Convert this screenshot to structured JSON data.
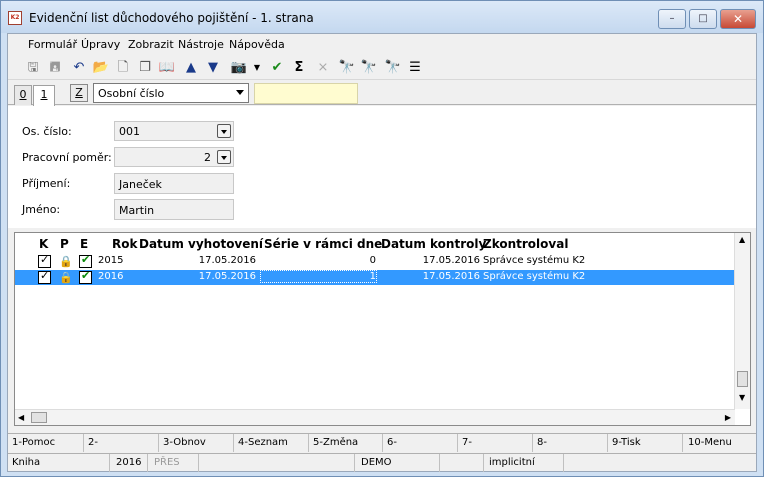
{
  "window": {
    "title": "Evidenční list důchodového pojištění - 1. strana",
    "app_icon_text": "K2",
    "min_label": "–",
    "max_label": "□",
    "close_label": "✕"
  },
  "menu": [
    "Formulář",
    "Úpravy",
    "Zobrazit",
    "Nástroje",
    "Nápověda"
  ],
  "toolbar": [
    "save-icon",
    "save-as-icon",
    "undo-icon",
    "open-folder-icon",
    "new-document-icon",
    "copy-icon",
    "book-icon",
    "arrow-up-icon",
    "arrow-down-icon",
    "camera-icon",
    "dropdown-arrow-icon",
    "filter-check-icon",
    "sum-icon",
    "filter-clear-icon",
    "binoculars-icon",
    "binoculars-next-icon",
    "binoculars-prev-icon",
    "menu-lines-icon"
  ],
  "tabs": {
    "tab0": "0",
    "tab1": "1",
    "z_button": "Z",
    "key_select": "Osobní číslo"
  },
  "form": {
    "os_cislo_label": "Os. číslo:",
    "os_cislo_value": "001",
    "pomer_label": "Pracovní poměr:",
    "pomer_value": "2",
    "prijmeni_label": "Příjmení:",
    "prijmeni_value": "Janeček",
    "jmeno_label": "Jméno:",
    "jmeno_value": "Martin"
  },
  "grid": {
    "headers": [
      "K",
      "P",
      "E",
      "Rok",
      "Datum vyhotovení",
      "Série v rámci dne",
      "Datum kontroly",
      "Zkontroloval"
    ],
    "rows": [
      {
        "rok": "2015",
        "vyhotoveni": "17.05.2016",
        "serie": "0",
        "kontrola": "17.05.2016",
        "zkontroloval": "Správce systému K2",
        "selected": false
      },
      {
        "rok": "2016",
        "vyhotoveni": "17.05.2016",
        "serie": "1",
        "kontrola": "17.05.2016",
        "zkontroloval": "Správce systému K2",
        "selected": true
      }
    ]
  },
  "fkeys": [
    "1-Pomoc",
    "2-",
    "3-Obnov",
    "4-Seznam",
    "5-Změna",
    "6-",
    "7-",
    "8-",
    "9-Tisk",
    "10-Menu"
  ],
  "status": {
    "kniha": "Kniha",
    "rok": "2016",
    "mode": "PŘES",
    "db": "DEMO",
    "profile": "implicitní"
  },
  "colors": {
    "selection": "#3399ff",
    "lock_green": "#6a9a1f",
    "check_green": "#0a8a0a"
  }
}
